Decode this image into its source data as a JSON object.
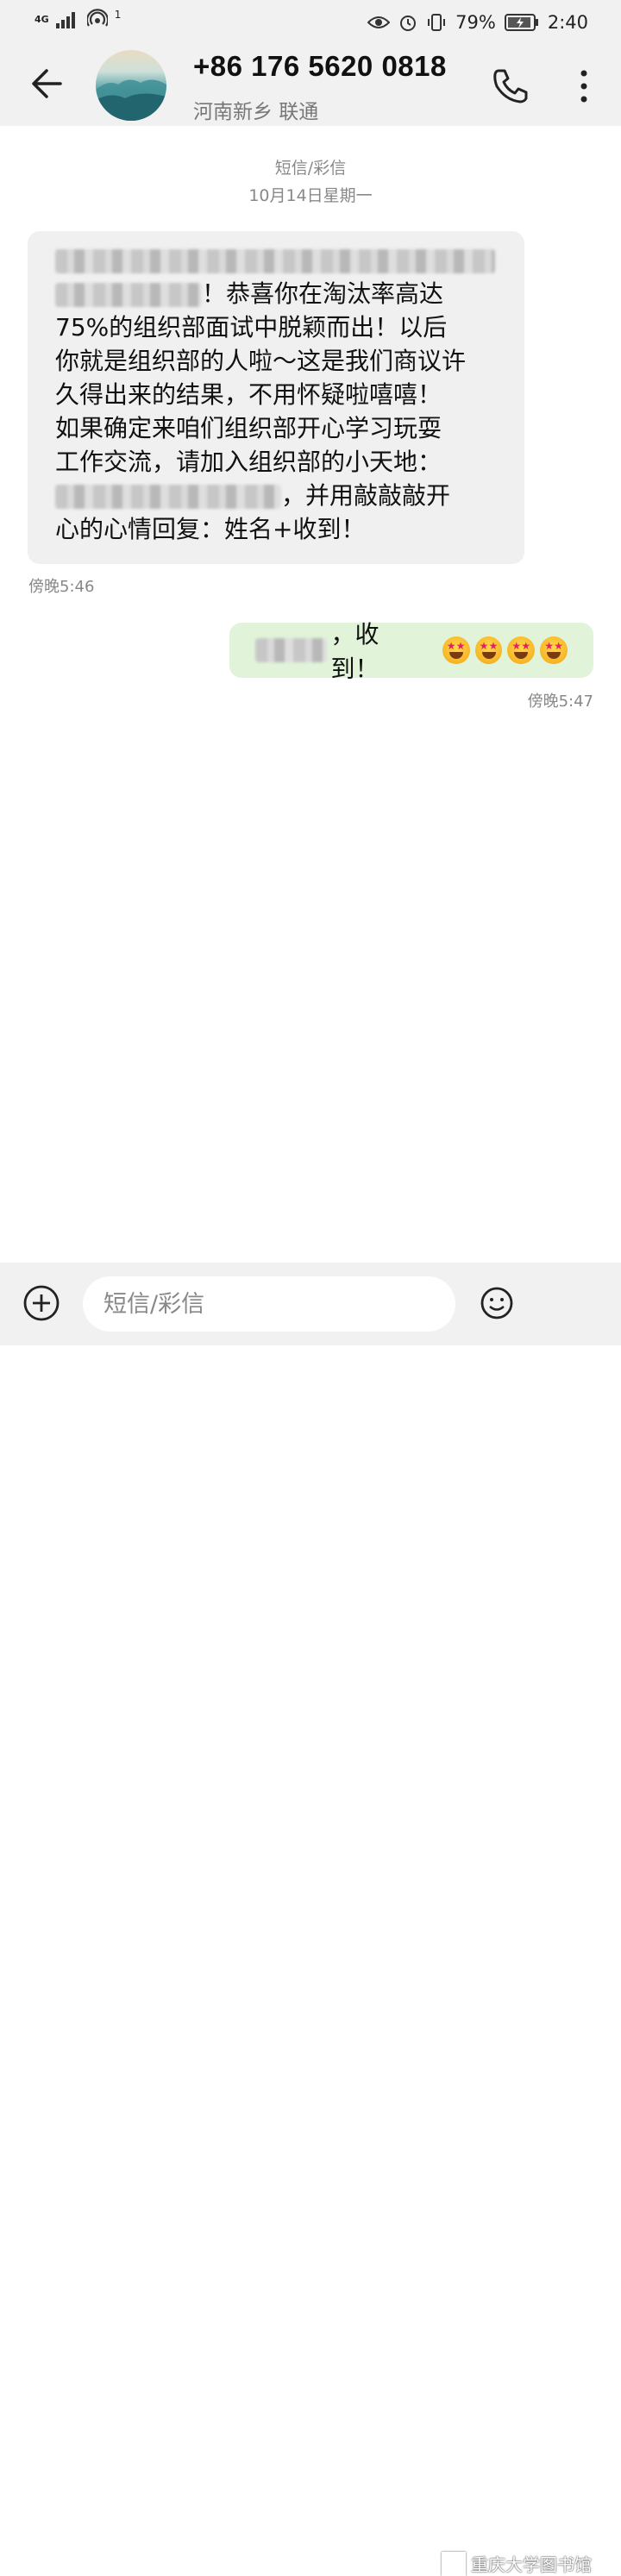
{
  "status_bar": {
    "network": "4G",
    "signal_extra": "1",
    "battery_percent": "79%",
    "time": "2:40"
  },
  "header": {
    "contact_number": "+86 176 5620 0818",
    "contact_location": "河南新乡 联通"
  },
  "conversation": {
    "type_label": "短信/彩信",
    "date_label": "10月14日星期一",
    "incoming": {
      "lines": [
        "",
        "！恭喜你在淘汰率高达",
        "75%的组织部面试中脱颖而出！以后",
        "你就是组织部的人啦～这是我们商议许",
        "久得出来的结果，不用怀疑啦嘻嘻！",
        "如果确定来咱们组织部开心学习玩耍",
        "工作交流，请加入组织部的小天地：",
        "，并用敲敲敲开",
        "心的心情回复：姓名+收到！"
      ],
      "time": "傍晚5:46"
    },
    "outgoing": {
      "text": "，收到！",
      "time": "傍晚5:47"
    }
  },
  "input": {
    "placeholder": "短信/彩信"
  },
  "watermark": {
    "text": "重庆大学图书馆"
  }
}
